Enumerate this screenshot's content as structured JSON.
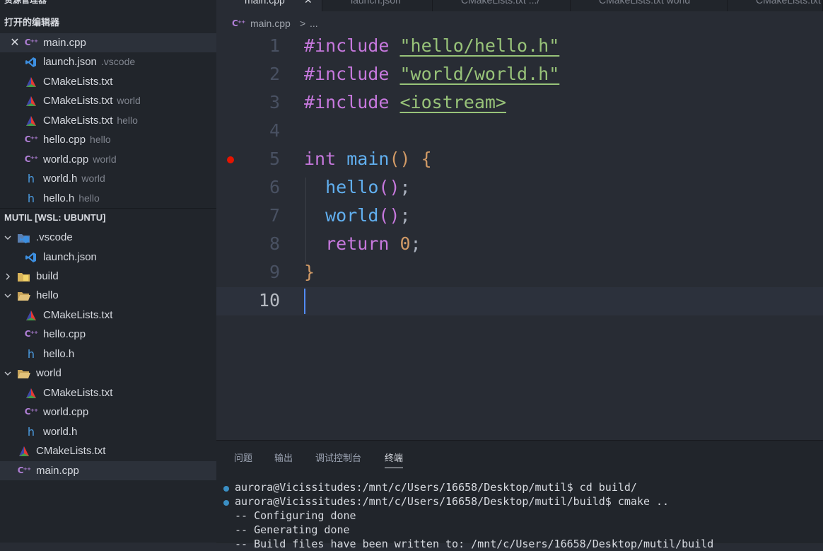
{
  "sidebar": {
    "top_title": "资源管理器",
    "open_editors_header": "打开的编辑器",
    "open_editors": [
      {
        "name": "main.cpp",
        "desc": "",
        "icon": "cpp-icon"
      },
      {
        "name": "launch.json",
        "desc": ".vscode",
        "icon": "vscode-icon"
      },
      {
        "name": "CMakeLists.txt",
        "desc": "",
        "icon": "cmake-icon"
      },
      {
        "name": "CMakeLists.txt",
        "desc": "world",
        "icon": "cmake-icon"
      },
      {
        "name": "CMakeLists.txt",
        "desc": "hello",
        "icon": "cmake-icon"
      },
      {
        "name": "hello.cpp",
        "desc": "hello",
        "icon": "cpp-icon"
      },
      {
        "name": "world.cpp",
        "desc": "world",
        "icon": "cpp-icon"
      },
      {
        "name": "world.h",
        "desc": "world",
        "icon": "h-icon"
      },
      {
        "name": "hello.h",
        "desc": "hello",
        "icon": "h-icon"
      }
    ],
    "workspace_header": "MUTIL [WSL: UBUNTU]",
    "tree": [
      {
        "name": ".vscode",
        "type": "folder"
      },
      {
        "name": "launch.json",
        "type": "file"
      },
      {
        "name": "build",
        "type": "folder"
      },
      {
        "name": "hello",
        "type": "folder"
      },
      {
        "name": "CMakeLists.txt",
        "type": "file"
      },
      {
        "name": "hello.cpp",
        "type": "file"
      },
      {
        "name": "hello.h",
        "type": "file"
      },
      {
        "name": "world",
        "type": "folder"
      },
      {
        "name": "CMakeLists.txt",
        "type": "file"
      },
      {
        "name": "world.cpp",
        "type": "file"
      },
      {
        "name": "world.h",
        "type": "file"
      },
      {
        "name": "CMakeLists.txt",
        "type": "file"
      },
      {
        "name": "main.cpp",
        "type": "file"
      }
    ]
  },
  "tabs": [
    {
      "label": "main.cpp"
    },
    {
      "label": "launch.json"
    },
    {
      "label": "CMakeLists.txt .../"
    },
    {
      "label": "CMakeLists.txt world"
    },
    {
      "label": "CMakeLists.txt h"
    }
  ],
  "breadcrumb": {
    "file": "main.cpp",
    "sep": ">",
    "more": "..."
  },
  "editor": {
    "line_numbers": [
      "1",
      "2",
      "3",
      "4",
      "5",
      "6",
      "7",
      "8",
      "9",
      "10"
    ],
    "code": {
      "include": "#include",
      "hello_h": "\"hello/hello.h\"",
      "world_h": "\"world/world.h\"",
      "iostream": "<iostream>",
      "int": "int",
      "main": "main",
      "lparen": "(",
      "rparen": ")",
      "lbrace": "{",
      "rbrace": "}",
      "hello_call": "hello",
      "world_call": "world",
      "semicolon": ";",
      "return": "return",
      "zero": "0"
    }
  },
  "panel": {
    "tabs": [
      "问题",
      "输出",
      "调试控制台",
      "终端"
    ],
    "terminal": [
      "aurora@Vicissitudes:/mnt/c/Users/16658/Desktop/mutil$ cd build/",
      "aurora@Vicissitudes:/mnt/c/Users/16658/Desktop/mutil/build$ cmake ..",
      "-- Configuring done",
      "-- Generating done",
      "-- Build files have been written to: /mnt/c/Users/16658/Desktop/mutil/build"
    ]
  },
  "colors": {
    "accent": "#528bff",
    "breakpoint": "#e51400",
    "keyword": "#c678dd",
    "function": "#61afef",
    "string": "#98c379"
  }
}
